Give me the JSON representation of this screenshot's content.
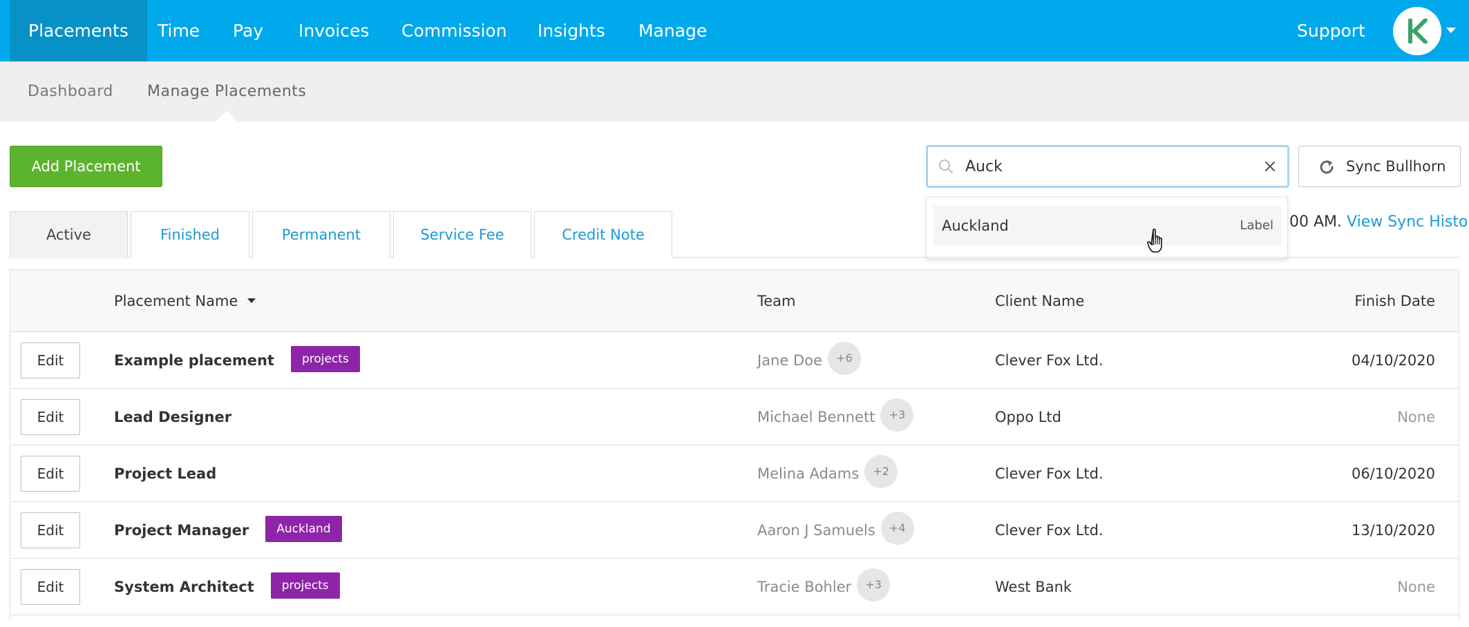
{
  "topnav": {
    "items": [
      {
        "label": "Placements",
        "active": true
      },
      {
        "label": "Time"
      },
      {
        "label": "Pay"
      },
      {
        "label": "Invoices"
      },
      {
        "label": "Commission"
      },
      {
        "label": "Insights"
      },
      {
        "label": "Manage"
      }
    ],
    "support_label": "Support",
    "avatar_icon": "kh-logo-icon",
    "brand_color": "#00a9eb"
  },
  "subnav": {
    "items": [
      {
        "label": "Dashboard"
      },
      {
        "label": "Manage Placements",
        "active": true
      }
    ]
  },
  "toolbar": {
    "add_label": "Add Placement",
    "sync_label": "Sync Bullhorn",
    "sync_info_prefix": "00 AM.",
    "sync_history_link": "View Sync History"
  },
  "search": {
    "value": "Auck",
    "placeholder": "",
    "suggestions": [
      {
        "label": "Auckland",
        "type": "Label"
      }
    ]
  },
  "tabs": [
    {
      "label": "Active",
      "active": true
    },
    {
      "label": "Finished"
    },
    {
      "label": "Permanent"
    },
    {
      "label": "Service Fee"
    },
    {
      "label": "Credit Note"
    }
  ],
  "table": {
    "columns": {
      "placement_name": "Placement Name",
      "team": "Team",
      "client_name": "Client Name",
      "finish_date": "Finish Date"
    },
    "edit_label": "Edit",
    "rows": [
      {
        "name": "Example placement",
        "tag": "projects",
        "team": "Jane Doe",
        "team_extra": "+6",
        "client": "Clever Fox Ltd.",
        "finish": "04/10/2020"
      },
      {
        "name": "Lead Designer",
        "tag": "",
        "team": "Michael Bennett",
        "team_extra": "+3",
        "client": "Oppo Ltd",
        "finish": "None"
      },
      {
        "name": "Project Lead",
        "tag": "",
        "team": "Melina Adams",
        "team_extra": "+2",
        "client": "Clever Fox Ltd.",
        "finish": "06/10/2020"
      },
      {
        "name": "Project Manager",
        "tag": "Auckland",
        "team": "Aaron J Samuels",
        "team_extra": "+4",
        "client": "Clever Fox Ltd.",
        "finish": "13/10/2020"
      },
      {
        "name": "System Architect",
        "tag": "projects",
        "team": "Tracie Bohler",
        "team_extra": "+3",
        "client": "West Bank",
        "finish": "None"
      }
    ]
  },
  "colors": {
    "add_button": "#5cb32d",
    "tag": "#8e25a9",
    "link": "#1a9ad6"
  }
}
